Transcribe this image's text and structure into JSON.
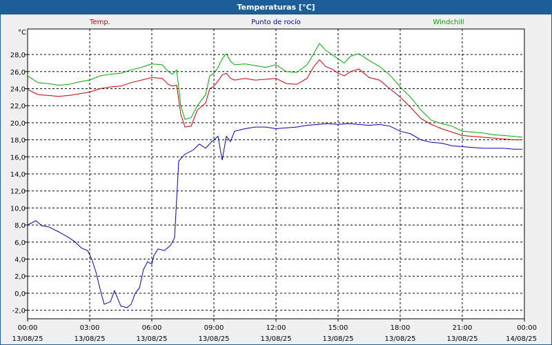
{
  "window": {
    "title": "Temperaturas [°C]"
  },
  "chart_data": {
    "type": "line",
    "title": "Temperaturas [°C]",
    "ylabel": "°C",
    "ylim": [
      -3,
      31
    ],
    "yticks": [
      -2,
      0,
      2,
      4,
      6,
      8,
      10,
      12,
      14,
      16,
      18,
      20,
      22,
      24,
      26,
      28
    ],
    "ytick_labels": [
      "-2,0",
      "0,0",
      "2,0",
      "4,0",
      "6,0",
      "8,0",
      "10,0",
      "12,0",
      "14,0",
      "16,0",
      "18,0",
      "20,0",
      "22,0",
      "24,0",
      "26,0",
      "28,0"
    ],
    "xlim": [
      0,
      24
    ],
    "xticks": [
      {
        "x": 0,
        "time": "00:00",
        "date": "13/08/25"
      },
      {
        "x": 3,
        "time": "03:00",
        "date": "13/08/25"
      },
      {
        "x": 6,
        "time": "06:00",
        "date": "13/08/25"
      },
      {
        "x": 9,
        "time": "09:00",
        "date": "13/08/25"
      },
      {
        "x": 12,
        "time": "12:00",
        "date": "13/08/25"
      },
      {
        "x": 15,
        "time": "15:00",
        "date": "13/08/25"
      },
      {
        "x": 18,
        "time": "18:00",
        "date": "13/08/25"
      },
      {
        "x": 21,
        "time": "21:00",
        "date": "13/08/25"
      },
      {
        "x": 24,
        "time": "00:00",
        "date": "14/08/25"
      }
    ],
    "grid": true,
    "legend_placement": "top",
    "series": [
      {
        "name": "Temp.",
        "color": "#cc0000",
        "points": [
          [
            0,
            23.9
          ],
          [
            0.5,
            23.3
          ],
          [
            1,
            23.2
          ],
          [
            1.5,
            23.1
          ],
          [
            2,
            23.2
          ],
          [
            2.5,
            23.4
          ],
          [
            3,
            23.6
          ],
          [
            3.5,
            24.0
          ],
          [
            4,
            24.2
          ],
          [
            4.5,
            24.3
          ],
          [
            5,
            24.7
          ],
          [
            5.5,
            25.0
          ],
          [
            6,
            25.3
          ],
          [
            6.5,
            25.2
          ],
          [
            6.8,
            24.5
          ],
          [
            7,
            24.3
          ],
          [
            7.2,
            24.4
          ],
          [
            7.4,
            21.0
          ],
          [
            7.6,
            19.5
          ],
          [
            7.9,
            19.6
          ],
          [
            8.2,
            21.5
          ],
          [
            8.6,
            22.3
          ],
          [
            8.8,
            24.0
          ],
          [
            9,
            24.3
          ],
          [
            9.2,
            24.9
          ],
          [
            9.4,
            25.6
          ],
          [
            9.6,
            25.8
          ],
          [
            9.8,
            25.2
          ],
          [
            10,
            25.0
          ],
          [
            10.5,
            25.2
          ],
          [
            11,
            25.0
          ],
          [
            11.5,
            25.1
          ],
          [
            12,
            25.2
          ],
          [
            12.5,
            24.6
          ],
          [
            13,
            24.5
          ],
          [
            13.5,
            25.2
          ],
          [
            13.8,
            26.5
          ],
          [
            14.1,
            27.4
          ],
          [
            14.4,
            26.6
          ],
          [
            14.7,
            26.3
          ],
          [
            15,
            25.8
          ],
          [
            15.3,
            25.5
          ],
          [
            15.6,
            26.0
          ],
          [
            16,
            26.3
          ],
          [
            16.5,
            25.3
          ],
          [
            17,
            25.0
          ],
          [
            17.5,
            24.0
          ],
          [
            18,
            23.0
          ],
          [
            18.5,
            21.8
          ],
          [
            19,
            20.5
          ],
          [
            19.5,
            19.8
          ],
          [
            20,
            19.3
          ],
          [
            20.5,
            18.9
          ],
          [
            21,
            18.5
          ],
          [
            21.5,
            18.4
          ],
          [
            22,
            18.3
          ],
          [
            22.5,
            18.2
          ],
          [
            23,
            18.1
          ],
          [
            23.5,
            18.0
          ],
          [
            23.9,
            18.0
          ]
        ]
      },
      {
        "name": "Punto de rocío",
        "color": "#0000bb",
        "points": [
          [
            0,
            8.0
          ],
          [
            0.4,
            8.5
          ],
          [
            0.7,
            7.9
          ],
          [
            1,
            7.8
          ],
          [
            1.5,
            7.2
          ],
          [
            2,
            6.5
          ],
          [
            2.3,
            6.0
          ],
          [
            2.6,
            5.3
          ],
          [
            2.9,
            5.0
          ],
          [
            3.1,
            4.0
          ],
          [
            3.3,
            2.5
          ],
          [
            3.5,
            0.5
          ],
          [
            3.7,
            -1.3
          ],
          [
            4,
            -1.0
          ],
          [
            4.2,
            0.3
          ],
          [
            4.5,
            -1.5
          ],
          [
            4.8,
            -1.7
          ],
          [
            5,
            -1.3
          ],
          [
            5.2,
            0.0
          ],
          [
            5.4,
            0.6
          ],
          [
            5.6,
            2.8
          ],
          [
            5.8,
            3.7
          ],
          [
            6,
            3.4
          ],
          [
            6.1,
            4.4
          ],
          [
            6.3,
            5.2
          ],
          [
            6.6,
            5.0
          ],
          [
            6.9,
            5.6
          ],
          [
            7.1,
            6.5
          ],
          [
            7.3,
            15.5
          ],
          [
            7.6,
            16.3
          ],
          [
            8,
            16.8
          ],
          [
            8.3,
            17.5
          ],
          [
            8.6,
            17.0
          ],
          [
            8.9,
            17.8
          ],
          [
            9.2,
            18.4
          ],
          [
            9.3,
            17.0
          ],
          [
            9.4,
            15.6
          ],
          [
            9.6,
            18.4
          ],
          [
            9.8,
            17.8
          ],
          [
            10,
            19.0
          ],
          [
            10.5,
            19.3
          ],
          [
            11,
            19.5
          ],
          [
            11.5,
            19.5
          ],
          [
            12,
            19.3
          ],
          [
            12.5,
            19.4
          ],
          [
            13,
            19.5
          ],
          [
            13.5,
            19.7
          ],
          [
            14,
            19.8
          ],
          [
            14.5,
            19.9
          ],
          [
            15,
            19.8
          ],
          [
            15.5,
            19.9
          ],
          [
            16,
            19.8
          ],
          [
            16.5,
            19.7
          ],
          [
            17,
            19.8
          ],
          [
            17.5,
            19.6
          ],
          [
            18,
            19.0
          ],
          [
            18.5,
            18.7
          ],
          [
            19,
            18.0
          ],
          [
            19.5,
            17.7
          ],
          [
            20,
            17.6
          ],
          [
            20.5,
            17.3
          ],
          [
            21,
            17.2
          ],
          [
            21.5,
            17.1
          ],
          [
            22,
            17.0
          ],
          [
            22.5,
            17.0
          ],
          [
            23,
            17.0
          ],
          [
            23.5,
            16.9
          ],
          [
            23.9,
            16.9
          ]
        ]
      },
      {
        "name": "Windchill",
        "color": "#00aa00",
        "points": [
          [
            0,
            25.5
          ],
          [
            0.5,
            24.7
          ],
          [
            1,
            24.6
          ],
          [
            1.5,
            24.4
          ],
          [
            2,
            24.5
          ],
          [
            2.5,
            24.8
          ],
          [
            3,
            25.0
          ],
          [
            3.5,
            25.5
          ],
          [
            4,
            25.7
          ],
          [
            4.5,
            25.8
          ],
          [
            5,
            26.2
          ],
          [
            5.5,
            26.5
          ],
          [
            6,
            26.9
          ],
          [
            6.5,
            26.8
          ],
          [
            6.8,
            26.0
          ],
          [
            7,
            25.7
          ],
          [
            7.2,
            26.2
          ],
          [
            7.4,
            22.0
          ],
          [
            7.6,
            20.4
          ],
          [
            7.9,
            20.6
          ],
          [
            8.2,
            22.0
          ],
          [
            8.6,
            23.3
          ],
          [
            8.8,
            25.5
          ],
          [
            9,
            25.8
          ],
          [
            9.2,
            26.5
          ],
          [
            9.4,
            27.5
          ],
          [
            9.6,
            28.1
          ],
          [
            9.8,
            27.2
          ],
          [
            10,
            26.8
          ],
          [
            10.5,
            26.9
          ],
          [
            11,
            26.7
          ],
          [
            11.5,
            26.5
          ],
          [
            12,
            26.8
          ],
          [
            12.5,
            26.0
          ],
          [
            13,
            25.9
          ],
          [
            13.5,
            26.8
          ],
          [
            13.8,
            28.0
          ],
          [
            14.1,
            29.3
          ],
          [
            14.4,
            28.5
          ],
          [
            14.7,
            28.0
          ],
          [
            15,
            27.5
          ],
          [
            15.3,
            27.0
          ],
          [
            15.6,
            27.8
          ],
          [
            16,
            28.1
          ],
          [
            16.5,
            27.3
          ],
          [
            17,
            26.6
          ],
          [
            17.5,
            25.6
          ],
          [
            18,
            24.2
          ],
          [
            18.5,
            23.0
          ],
          [
            19,
            21.5
          ],
          [
            19.5,
            20.3
          ],
          [
            20,
            19.9
          ],
          [
            20.5,
            19.6
          ],
          [
            21,
            19.0
          ],
          [
            21.5,
            18.9
          ],
          [
            22,
            18.8
          ],
          [
            22.5,
            18.6
          ],
          [
            23,
            18.5
          ],
          [
            23.5,
            18.4
          ],
          [
            23.9,
            18.3
          ]
        ]
      }
    ]
  }
}
